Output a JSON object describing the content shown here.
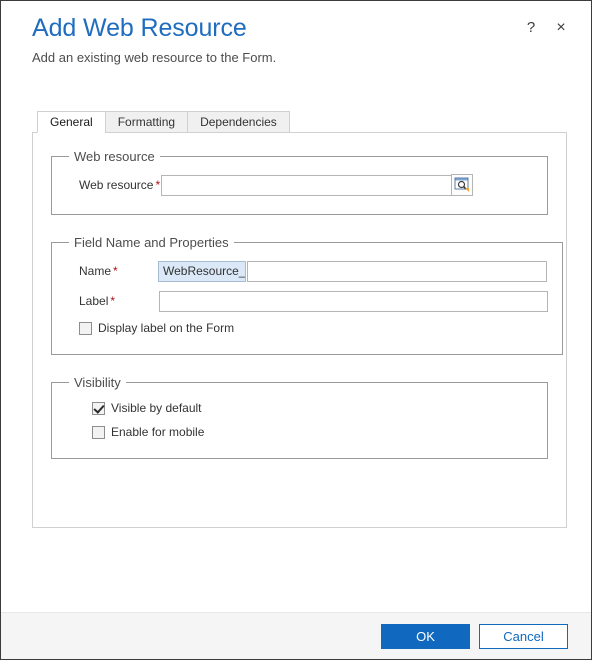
{
  "dialog": {
    "title": "Add Web Resource",
    "subtitle": "Add an existing web resource to the Form.",
    "help_label": "?",
    "close_label": "×"
  },
  "tabs": [
    {
      "label": "General",
      "active": true
    },
    {
      "label": "Formatting",
      "active": false
    },
    {
      "label": "Dependencies",
      "active": false
    }
  ],
  "groups": {
    "web_resource": {
      "legend": "Web resource",
      "field_label": "Web resource",
      "required_marker": "*",
      "value": "",
      "placeholder": "",
      "lookup_icon": "lookup-browse-icon"
    },
    "field_name": {
      "legend": "Field Name and Properties",
      "name_label": "Name",
      "name_required_marker": "*",
      "name_prefix": "WebResource_",
      "name_value": "",
      "label_label": "Label",
      "label_required_marker": "*",
      "label_value": "",
      "display_label_checkbox": {
        "label": "Display label on the Form",
        "checked": false
      }
    },
    "visibility": {
      "legend": "Visibility",
      "visible_by_default": {
        "label": "Visible by default",
        "checked": true
      },
      "enable_for_mobile": {
        "label": "Enable for mobile",
        "checked": false
      }
    }
  },
  "footer": {
    "ok_label": "OK",
    "cancel_label": "Cancel"
  },
  "colors": {
    "title_blue": "#1f6cc0",
    "primary_button": "#1169bf",
    "required_red": "#b01116",
    "prefix_background": "#dae8f7",
    "footer_background": "#f5f5f5"
  }
}
